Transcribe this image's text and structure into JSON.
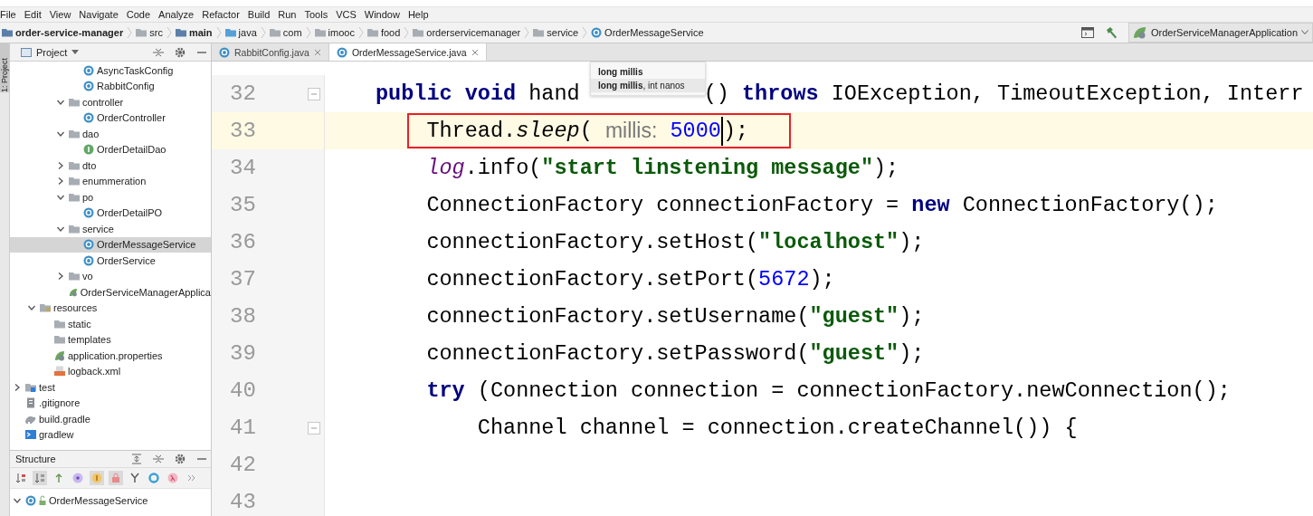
{
  "menu": [
    "File",
    "Edit",
    "View",
    "Navigate",
    "Code",
    "Analyze",
    "Refactor",
    "Build",
    "Run",
    "Tools",
    "VCS",
    "Window",
    "Help"
  ],
  "breadcrumbs": [
    {
      "label": "order-service-manager",
      "kind": "module"
    },
    {
      "label": "src",
      "kind": "folder"
    },
    {
      "label": "main",
      "kind": "module"
    },
    {
      "label": "java",
      "kind": "source"
    },
    {
      "label": "com",
      "kind": "folder"
    },
    {
      "label": "imooc",
      "kind": "folder"
    },
    {
      "label": "food",
      "kind": "folder"
    },
    {
      "label": "orderservicemanager",
      "kind": "folder"
    },
    {
      "label": "service",
      "kind": "folder"
    },
    {
      "label": "OrderMessageService",
      "kind": "class"
    }
  ],
  "run_config": "OrderServiceManagerApplication",
  "tool_strip": "1: Project",
  "project_panel": {
    "title": "Project",
    "tree": [
      {
        "children": [
          {
            "children": [
              {
                "children": [
                  {
                    "children": [
                      {
                        "label": "AsyncTaskConfig",
                        "kind": "class",
                        "selected": false
                      },
                      {
                        "label": "RabbitConfig",
                        "kind": "class",
                        "selected": false
                      }
                    ]
                  },
                  {
                    "label": "controller",
                    "kind": "folder",
                    "expanded": true,
                    "selected": false,
                    "children": [
                      {
                        "label": "OrderController",
                        "kind": "class",
                        "selected": false
                      }
                    ]
                  },
                  {
                    "label": "dao",
                    "kind": "folder",
                    "expanded": true,
                    "selected": false,
                    "children": [
                      {
                        "label": "OrderDetailDao",
                        "kind": "interface",
                        "selected": false
                      }
                    ]
                  },
                  {
                    "label": "dto",
                    "kind": "folder",
                    "expanded": false,
                    "selected": false
                  },
                  {
                    "label": "enummeration",
                    "kind": "folder",
                    "expanded": false,
                    "selected": false
                  },
                  {
                    "label": "po",
                    "kind": "folder",
                    "expanded": true,
                    "selected": false,
                    "children": [
                      {
                        "label": "OrderDetailPO",
                        "kind": "class",
                        "selected": false
                      }
                    ]
                  },
                  {
                    "label": "service",
                    "kind": "folder",
                    "expanded": true,
                    "selected": false,
                    "children": [
                      {
                        "label": "OrderMessageService",
                        "kind": "class",
                        "selected": true
                      },
                      {
                        "label": "OrderService",
                        "kind": "class",
                        "selected": false
                      }
                    ]
                  },
                  {
                    "label": "vo",
                    "kind": "folder",
                    "expanded": false,
                    "selected": false
                  },
                  {
                    "label": "OrderServiceManagerApplica",
                    "kind": "spring",
                    "selected": false
                  }
                ]
              }
            ]
          },
          {
            "label": "resources",
            "kind": "resources",
            "expanded": true,
            "selected": false,
            "children": [
              {
                "label": "static",
                "kind": "folder",
                "selected": false
              },
              {
                "label": "templates",
                "kind": "folder",
                "selected": false
              },
              {
                "label": "application.properties",
                "kind": "spring",
                "selected": false
              },
              {
                "label": "logback.xml",
                "kind": "xml",
                "selected": false
              }
            ]
          }
        ]
      },
      {
        "label": "test",
        "kind": "test",
        "expanded": false,
        "selected": false
      },
      {
        "label": ".gitignore",
        "kind": "file",
        "selected": false
      },
      {
        "label": "build.gradle",
        "kind": "gradle",
        "selected": false
      },
      {
        "label": "gradlew",
        "kind": "script",
        "selected": false
      }
    ]
  },
  "structure_panel": {
    "title": "Structure",
    "root": {
      "label": "OrderMessageService",
      "expanded": true
    }
  },
  "editor_tabs": [
    {
      "label": "RabbitConfig.java",
      "selected": false
    },
    {
      "label": "OrderMessageService.java",
      "selected": true
    }
  ],
  "tooltip": [
    {
      "bold": "long millis"
    },
    {
      "bold": "long millis",
      "rest": ", int nanos"
    }
  ],
  "code_lines": [
    {
      "number": "32",
      "fold": true,
      "current": false,
      "annotated": false,
      "tokens": [
        {
          "kind": "kw",
          "text": "public void"
        },
        {
          "kind": "plain",
          "text": " hand"
        },
        {
          "kind": "gap"
        },
        {
          "kind": "plain",
          "text": "() "
        },
        {
          "kind": "kw",
          "text": "throws"
        },
        {
          "kind": "plain",
          "text": " IOException, TimeoutException, Interr"
        }
      ]
    },
    {
      "number": "33",
      "fold": false,
      "current": true,
      "annotated": true,
      "tokens": [
        {
          "kind": "plain",
          "text": "    Thread."
        },
        {
          "kind": "method",
          "text": "sleep"
        },
        {
          "kind": "plain",
          "text": "( "
        },
        {
          "kind": "hint",
          "text": "millis:"
        },
        {
          "kind": "num",
          "text": " 5000"
        },
        {
          "kind": "caret"
        },
        {
          "kind": "plain",
          "text": ");"
        }
      ]
    },
    {
      "number": "34",
      "fold": false,
      "current": false,
      "annotated": false,
      "tokens": [
        {
          "kind": "field",
          "text": "    log"
        },
        {
          "kind": "plain",
          "text": ".info("
        },
        {
          "kind": "str",
          "text": "\"start linstening message\""
        },
        {
          "kind": "plain",
          "text": ");"
        }
      ]
    },
    {
      "number": "35",
      "fold": false,
      "current": false,
      "annotated": false,
      "tokens": [
        {
          "kind": "plain",
          "text": "    ConnectionFactory connectionFactory = "
        },
        {
          "kind": "kw",
          "text": "new"
        },
        {
          "kind": "plain",
          "text": " ConnectionFactory();"
        }
      ]
    },
    {
      "number": "36",
      "fold": false,
      "current": false,
      "annotated": false,
      "tokens": [
        {
          "kind": "plain",
          "text": "    connectionFactory.setHost("
        },
        {
          "kind": "str",
          "text": "\"localhost\""
        },
        {
          "kind": "plain",
          "text": ");"
        }
      ]
    },
    {
      "number": "37",
      "fold": false,
      "current": false,
      "annotated": false,
      "tokens": [
        {
          "kind": "plain",
          "text": "    connectionFactory.setPort("
        },
        {
          "kind": "num",
          "text": "5672"
        },
        {
          "kind": "plain",
          "text": ");"
        }
      ]
    },
    {
      "number": "38",
      "fold": false,
      "current": false,
      "annotated": false,
      "tokens": [
        {
          "kind": "plain",
          "text": "    connectionFactory.setUsername("
        },
        {
          "kind": "str",
          "text": "\"guest\""
        },
        {
          "kind": "plain",
          "text": ");"
        }
      ]
    },
    {
      "number": "39",
      "fold": false,
      "current": false,
      "annotated": false,
      "tokens": [
        {
          "kind": "plain",
          "text": "    connectionFactory.setPassword("
        },
        {
          "kind": "str",
          "text": "\"guest\""
        },
        {
          "kind": "plain",
          "text": ");"
        }
      ]
    },
    {
      "number": "40",
      "fold": false,
      "current": false,
      "annotated": false,
      "tokens": [
        {
          "kind": "kw",
          "text": "    try"
        },
        {
          "kind": "plain",
          "text": " (Connection connection = connectionFactory.newConnection();"
        }
      ]
    },
    {
      "number": "41",
      "fold": true,
      "current": false,
      "annotated": false,
      "tokens": [
        {
          "kind": "plain",
          "text": "        Channel channel = connection.createChannel()) {"
        }
      ]
    },
    {
      "number": "42",
      "fold": false,
      "current": false,
      "annotated": false
    },
    {
      "number": "43",
      "fold": false,
      "current": false,
      "annotated": false
    }
  ]
}
